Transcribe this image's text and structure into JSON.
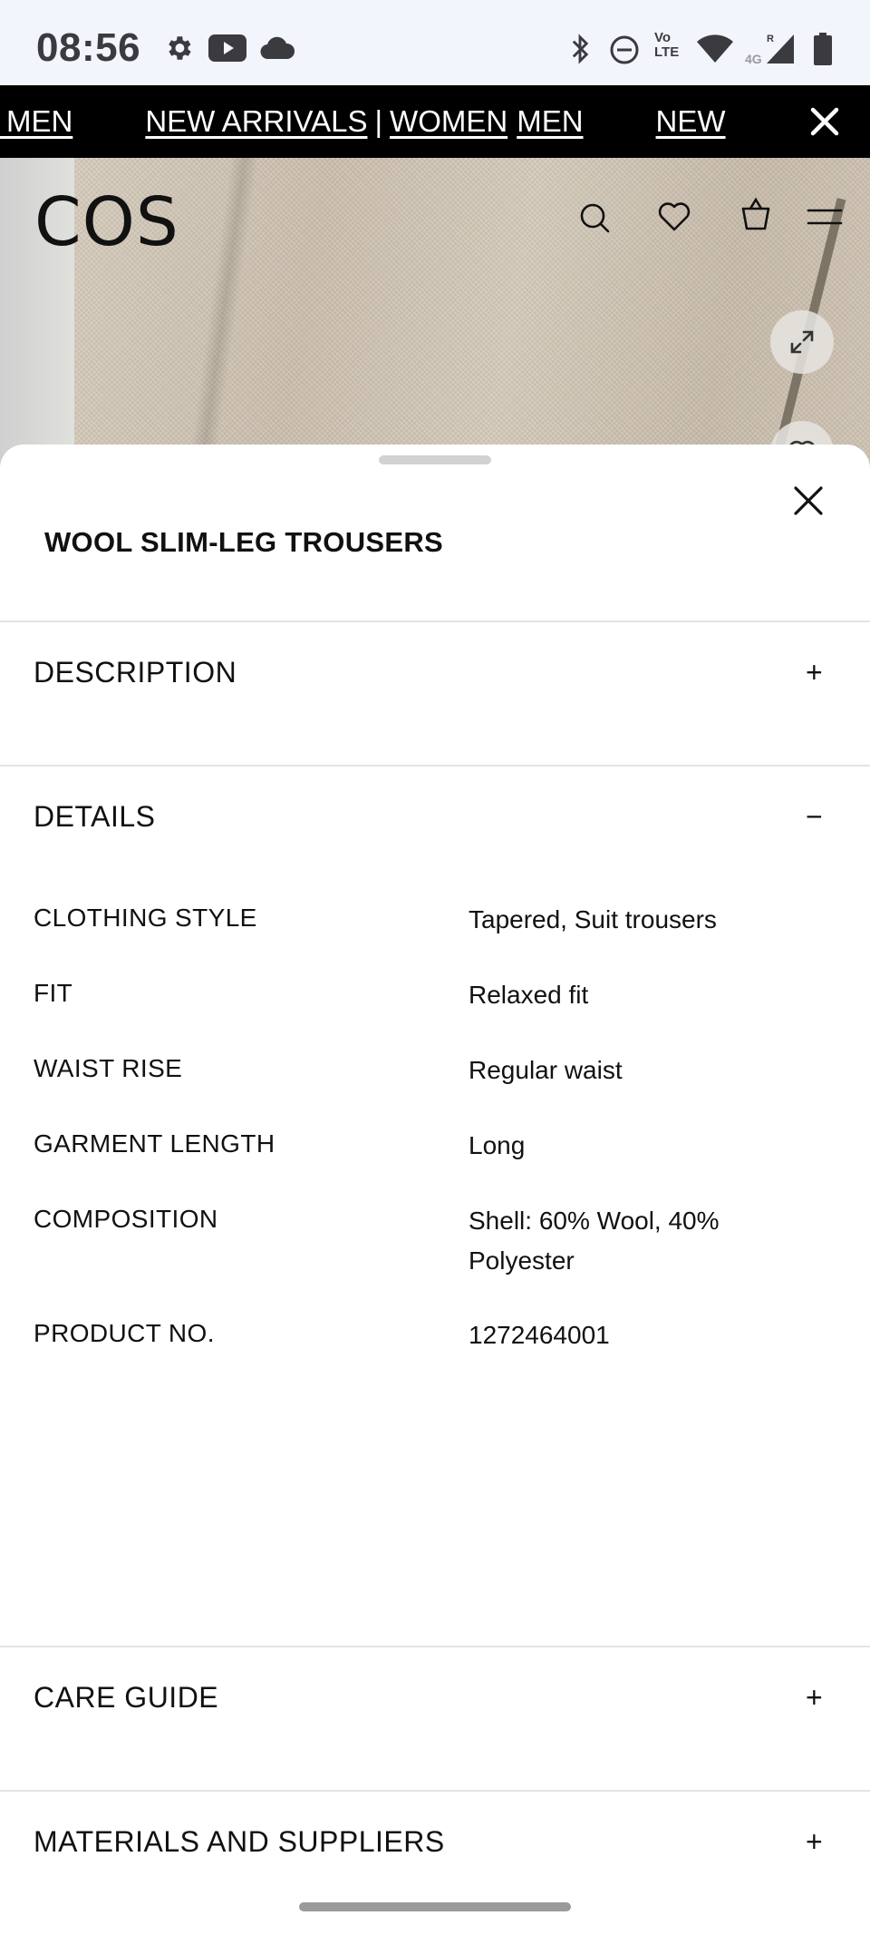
{
  "status_bar": {
    "time": "08:56",
    "left_icons": [
      "gear-icon",
      "youtube-icon",
      "cloud-icon"
    ],
    "right_icons": [
      "bluetooth-icon",
      "do-not-disturb-icon",
      "volte-icon",
      "wifi-icon",
      "cell-signal-icon",
      "battery-icon"
    ],
    "volte_text": "Vo LTE",
    "network_text": "4G",
    "roaming_text": "R"
  },
  "promo_bar": {
    "items": [
      "N MEN",
      "NEW ARRIVALS",
      "|",
      "WOMEN",
      "MEN",
      "NEW"
    ],
    "background": "#000000"
  },
  "header": {
    "logo": "COS",
    "icons": [
      "search-icon",
      "heart-icon",
      "bag-icon",
      "menu-icon"
    ]
  },
  "sheet": {
    "title": "WOOL SLIM-LEG TROUSERS",
    "sections": {
      "description": {
        "label": "DESCRIPTION",
        "toggle": "+"
      },
      "details": {
        "label": "DETAILS",
        "toggle": "−"
      },
      "care": {
        "label": "CARE GUIDE",
        "toggle": "+"
      },
      "materials": {
        "label": "MATERIALS AND SUPPLIERS",
        "toggle": "+"
      }
    },
    "details": [
      {
        "label": "CLOTHING STYLE",
        "value": "Tapered, Suit trousers"
      },
      {
        "label": "FIT",
        "value": "Relaxed fit"
      },
      {
        "label": "WAIST RISE",
        "value": "Regular waist"
      },
      {
        "label": "GARMENT LENGTH",
        "value": "Long"
      },
      {
        "label": "COMPOSITION",
        "value": "Shell: 60% Wool, 40% Polyester"
      },
      {
        "label": "PRODUCT NO.",
        "value": "1272464001"
      }
    ]
  }
}
